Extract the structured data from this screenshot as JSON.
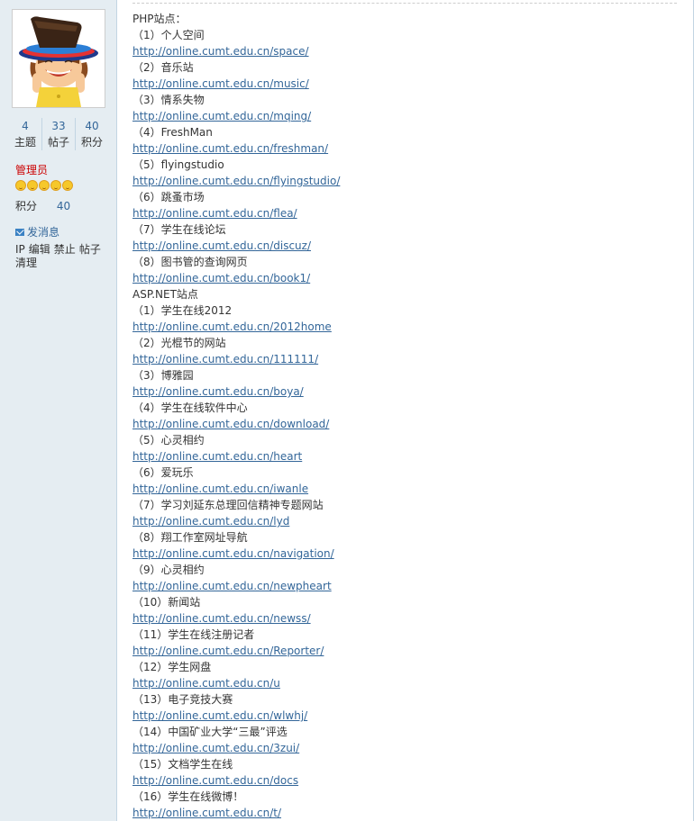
{
  "user": {
    "stats": [
      {
        "value": "4",
        "label": "主题"
      },
      {
        "value": "33",
        "label": "帖子"
      },
      {
        "value": "40",
        "label": "积分"
      }
    ],
    "role": "管理员",
    "points_label": "积分",
    "points_value": "40",
    "pm_label": "发消息",
    "admin_links": [
      "IP",
      "编辑",
      "禁止",
      "帖子",
      "清理"
    ]
  },
  "post": {
    "lines": [
      {
        "text": "PHP站点：",
        "kind": "text"
      },
      {
        "text": "（1）个人空间",
        "kind": "text"
      },
      {
        "text": "http://online.cumt.edu.cn/space/",
        "kind": "link"
      },
      {
        "text": "（2）音乐站",
        "kind": "text"
      },
      {
        "text": "http://online.cumt.edu.cn/music/",
        "kind": "link"
      },
      {
        "text": "（3）情系失物",
        "kind": "text"
      },
      {
        "text": "http://online.cumt.edu.cn/mqing/",
        "kind": "link"
      },
      {
        "text": "（4）FreshMan",
        "kind": "text"
      },
      {
        "text": "http://online.cumt.edu.cn/freshman/",
        "kind": "link"
      },
      {
        "text": "（5）flyingstudio",
        "kind": "text"
      },
      {
        "text": "http://online.cumt.edu.cn/flyingstudio/",
        "kind": "link"
      },
      {
        "text": "（6）跳蚤市场",
        "kind": "text"
      },
      {
        "text": "http://online.cumt.edu.cn/flea/",
        "kind": "link"
      },
      {
        "text": "（7）学生在线论坛",
        "kind": "text"
      },
      {
        "text": "http://online.cumt.edu.cn/discuz/",
        "kind": "link"
      },
      {
        "text": "（8）图书管的查询网页",
        "kind": "text"
      },
      {
        "text": "http://online.cumt.edu.cn/book1/",
        "kind": "link"
      },
      {
        "text": "ASP.NET站点",
        "kind": "text"
      },
      {
        "text": "（1）学生在线2012",
        "kind": "text"
      },
      {
        "text": "http://online.cumt.edu.cn/2012home",
        "kind": "link"
      },
      {
        "text": "（2）光棍节的网站",
        "kind": "text"
      },
      {
        "text": "http://online.cumt.edu.cn/111111/",
        "kind": "link"
      },
      {
        "text": "（3）博雅园",
        "kind": "text"
      },
      {
        "text": "http://online.cumt.edu.cn/boya/",
        "kind": "link"
      },
      {
        "text": "（4）学生在线软件中心",
        "kind": "text"
      },
      {
        "text": "http://online.cumt.edu.cn/download/",
        "kind": "link"
      },
      {
        "text": "（5）心灵相约",
        "kind": "text"
      },
      {
        "text": "http://online.cumt.edu.cn/heart",
        "kind": "link"
      },
      {
        "text": "（6）爱玩乐",
        "kind": "text"
      },
      {
        "text": "http://online.cumt.edu.cn/iwanle",
        "kind": "link"
      },
      {
        "text": "（7）学习刘延东总理回信精神专题网站",
        "kind": "text"
      },
      {
        "text": "http://online.cumt.edu.cn/lyd",
        "kind": "link"
      },
      {
        "text": "（8）翔工作室网址导航",
        "kind": "text"
      },
      {
        "text": "http://online.cumt.edu.cn/navigation/",
        "kind": "link"
      },
      {
        "text": "（9）心灵相约",
        "kind": "text"
      },
      {
        "text": "http://online.cumt.edu.cn/newpheart",
        "kind": "link"
      },
      {
        "text": "（10）新闻站",
        "kind": "text"
      },
      {
        "text": "http://online.cumt.edu.cn/newss/",
        "kind": "link"
      },
      {
        "text": "（11）学生在线注册记者",
        "kind": "text"
      },
      {
        "text": "http://online.cumt.edu.cn/Reporter/",
        "kind": "link"
      },
      {
        "text": "（12）学生网盘",
        "kind": "text"
      },
      {
        "text": "http://online.cumt.edu.cn/u",
        "kind": "link"
      },
      {
        "text": "（13）电子竞技大赛",
        "kind": "text"
      },
      {
        "text": "http://online.cumt.edu.cn/wlwhj/",
        "kind": "link"
      },
      {
        "text": "（14）中国矿业大学“三最”评选",
        "kind": "text"
      },
      {
        "text": "http://online.cumt.edu.cn/3zui/",
        "kind": "link"
      },
      {
        "text": "（15）文档学生在线",
        "kind": "text"
      },
      {
        "text": "http://online.cumt.edu.cn/docs",
        "kind": "link"
      },
      {
        "text": "（16）学生在线微博！",
        "kind": "text"
      },
      {
        "text": "http://online.cumt.edu.cn/t/",
        "kind": "link"
      }
    ]
  }
}
